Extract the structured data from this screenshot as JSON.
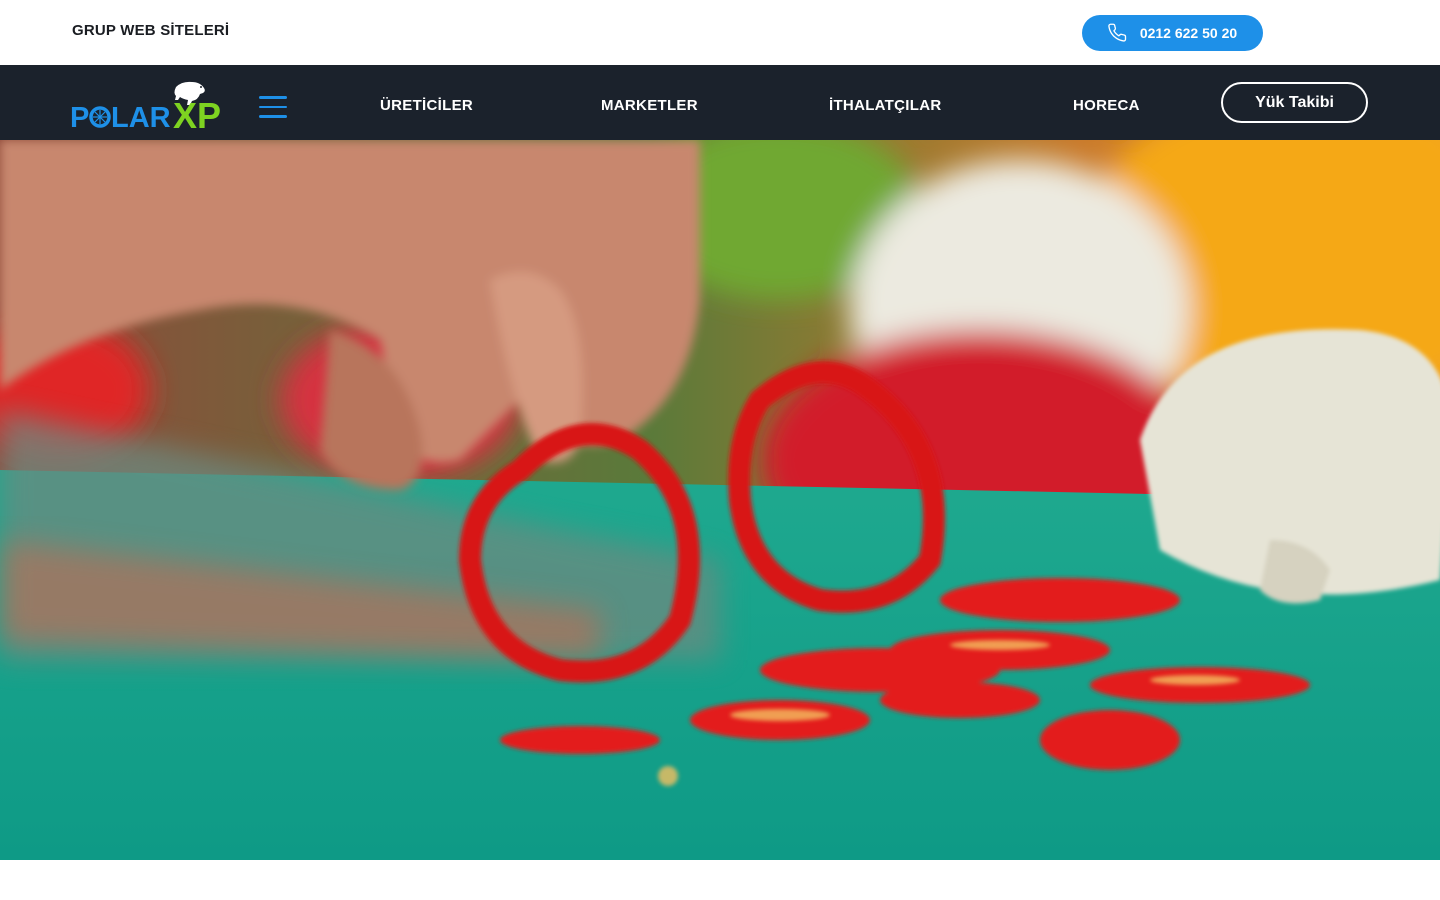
{
  "topbar": {
    "group_sites": "GRUP WEB SİTELERİ",
    "phone": "0212 622 50 20"
  },
  "logo": {
    "text_polar": "POLAR",
    "text_xp": "XP",
    "color_polar": "#1e90e8",
    "color_xp": "#7ed321"
  },
  "nav": {
    "items": [
      {
        "label": "ÜRETİCİLER"
      },
      {
        "label": "MARKETLER"
      },
      {
        "label": "İTHALATÇILAR"
      },
      {
        "label": "HORECA"
      }
    ],
    "track_button": "Yük Takibi"
  },
  "hero": {
    "image": "sliced-red-peppers-on-cutting-board"
  },
  "colors": {
    "accent": "#1e90e8",
    "nav_bg": "#1b222c",
    "green": "#7ed321"
  }
}
